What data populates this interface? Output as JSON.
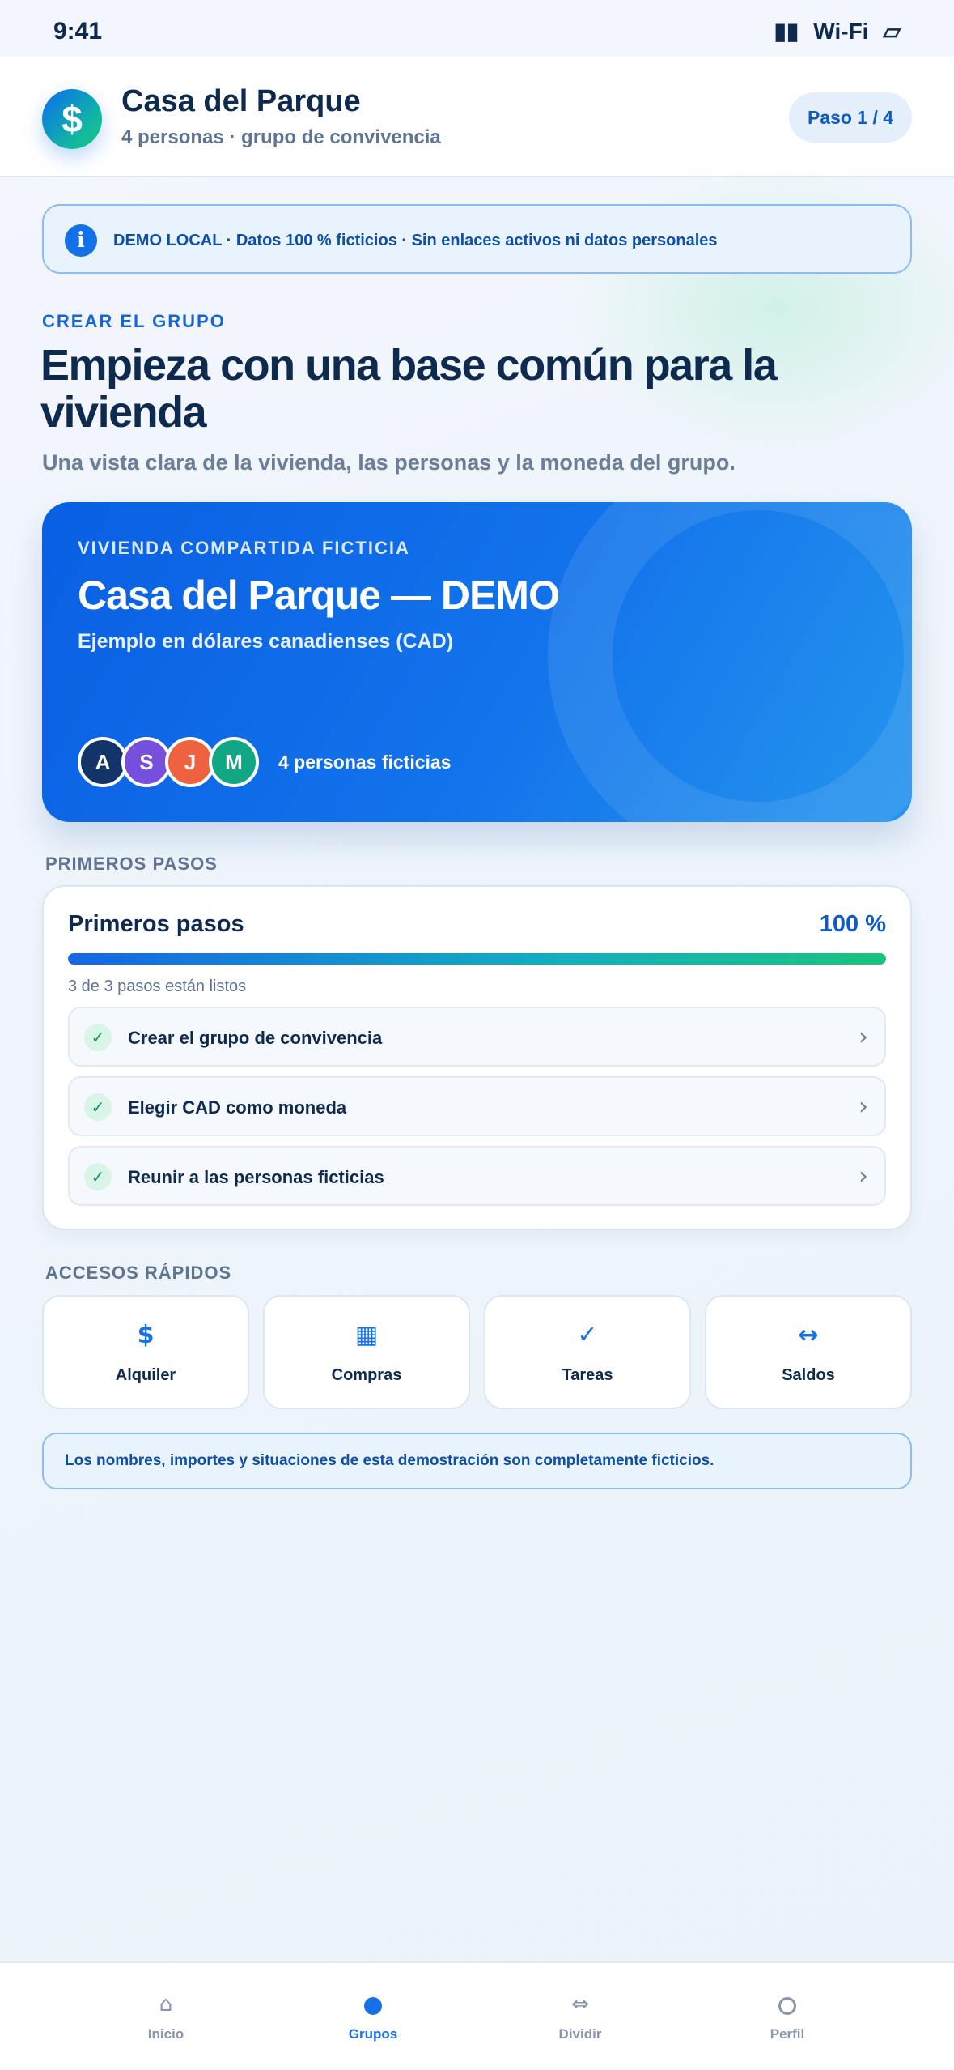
{
  "status_bar": {
    "time": "9:41",
    "signal": "▮▮",
    "wifi": "Wi-Fi",
    "battery": "▱"
  },
  "header": {
    "logo_symbol": "$",
    "title": "Casa del Parque",
    "subtitle": "4 personas · grupo de convivencia",
    "step_label": "Paso 1 / 4"
  },
  "demo_banner": {
    "icon": "i",
    "text": "DEMO LOCAL · Datos 100 % ficticios · Sin enlaces activos ni datos personales"
  },
  "intro": {
    "eyebrow": "CREAR EL GRUPO",
    "headline": "Empieza con una base común para la vivienda",
    "lead": "Una vista clara de la vivienda, las personas y la moneda del grupo."
  },
  "hero": {
    "eyebrow": "VIVIENDA COMPARTIDA FICTICIA",
    "title": "Casa del Parque — DEMO",
    "subtitle": "Ejemplo en dólares canadienses (CAD)",
    "avatars": [
      {
        "initial": "A",
        "color": "#123468"
      },
      {
        "initial": "S",
        "color": "#7650dc"
      },
      {
        "initial": "J",
        "color": "#ef6240"
      },
      {
        "initial": "M",
        "color": "#12a784"
      }
    ],
    "people_label": "4 personas ficticias"
  },
  "first_steps": {
    "section_label": "PRIMEROS PASOS",
    "title": "Primeros pasos",
    "percent_label": "100 %",
    "progress_fraction": 1.0,
    "progress_note": "3 de 3 pasos están listos",
    "items": [
      {
        "label": "Crear el grupo de convivencia",
        "check": "✓",
        "chevron": "›"
      },
      {
        "label": "Elegir CAD como moneda",
        "check": "✓",
        "chevron": "›"
      },
      {
        "label": "Reunir a las personas ficticias",
        "check": "✓",
        "chevron": "›"
      }
    ]
  },
  "quick_access": {
    "section_label": "ACCESOS RÁPIDOS",
    "tiles": [
      {
        "icon": "$",
        "icon_name": "dollar-icon",
        "label": "Alquiler"
      },
      {
        "icon": "▦",
        "icon_name": "grid-icon",
        "label": "Compras"
      },
      {
        "icon": "✓",
        "icon_name": "check-icon",
        "label": "Tareas"
      },
      {
        "icon": "↔",
        "icon_name": "swap-icon",
        "label": "Saldos"
      }
    ]
  },
  "footnote": "Los nombres, importes y situaciones de esta demostración son completamente ficticios.",
  "tabbar": {
    "tabs": [
      {
        "label": "Inicio",
        "icon": "⌂",
        "icon_name": "home-icon",
        "active": false
      },
      {
        "label": "Grupos",
        "icon_name": "groups-icon",
        "active": true
      },
      {
        "label": "Dividir",
        "icon": "⇔",
        "icon_name": "split-icon",
        "active": false
      },
      {
        "label": "Perfil",
        "icon_name": "profile-icon",
        "active": false
      }
    ]
  },
  "colors": {
    "accent": "#1670e8",
    "ink": "#0f2a4f",
    "success": "#19c37d",
    "banner_bg": "#e9f3fe"
  }
}
